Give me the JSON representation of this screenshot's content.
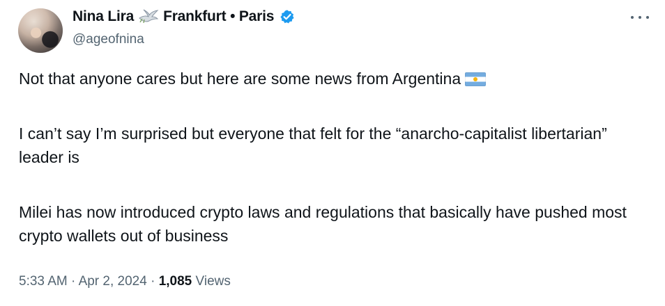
{
  "author": {
    "name": "Nina Lira",
    "location": "Frankfurt • Paris",
    "handle": "@ageofnina"
  },
  "tweet": {
    "paragraph1": "Not that anyone cares but here are some news from Argentina",
    "paragraph2": "I can’t say I’m surprised but everyone that felt for the “anarcho-capitalist libertarian” leader is",
    "paragraph3": "Milei has now introduced crypto laws and regulations that basically have pushed most crypto wallets out of business"
  },
  "meta": {
    "time": "5:33 AM",
    "separator1": " · ",
    "date": "Apr 2, 2024",
    "separator2": " · ",
    "views_count": "1,085",
    "views_label": " Views"
  },
  "icons": {
    "dove": "dove-icon",
    "verified": "verified-badge-icon",
    "flag": "argentina-flag-icon",
    "more": "more-options-icon"
  },
  "colors": {
    "text": "#0f1419",
    "secondary": "#536471",
    "verified": "#1d9bf0"
  }
}
